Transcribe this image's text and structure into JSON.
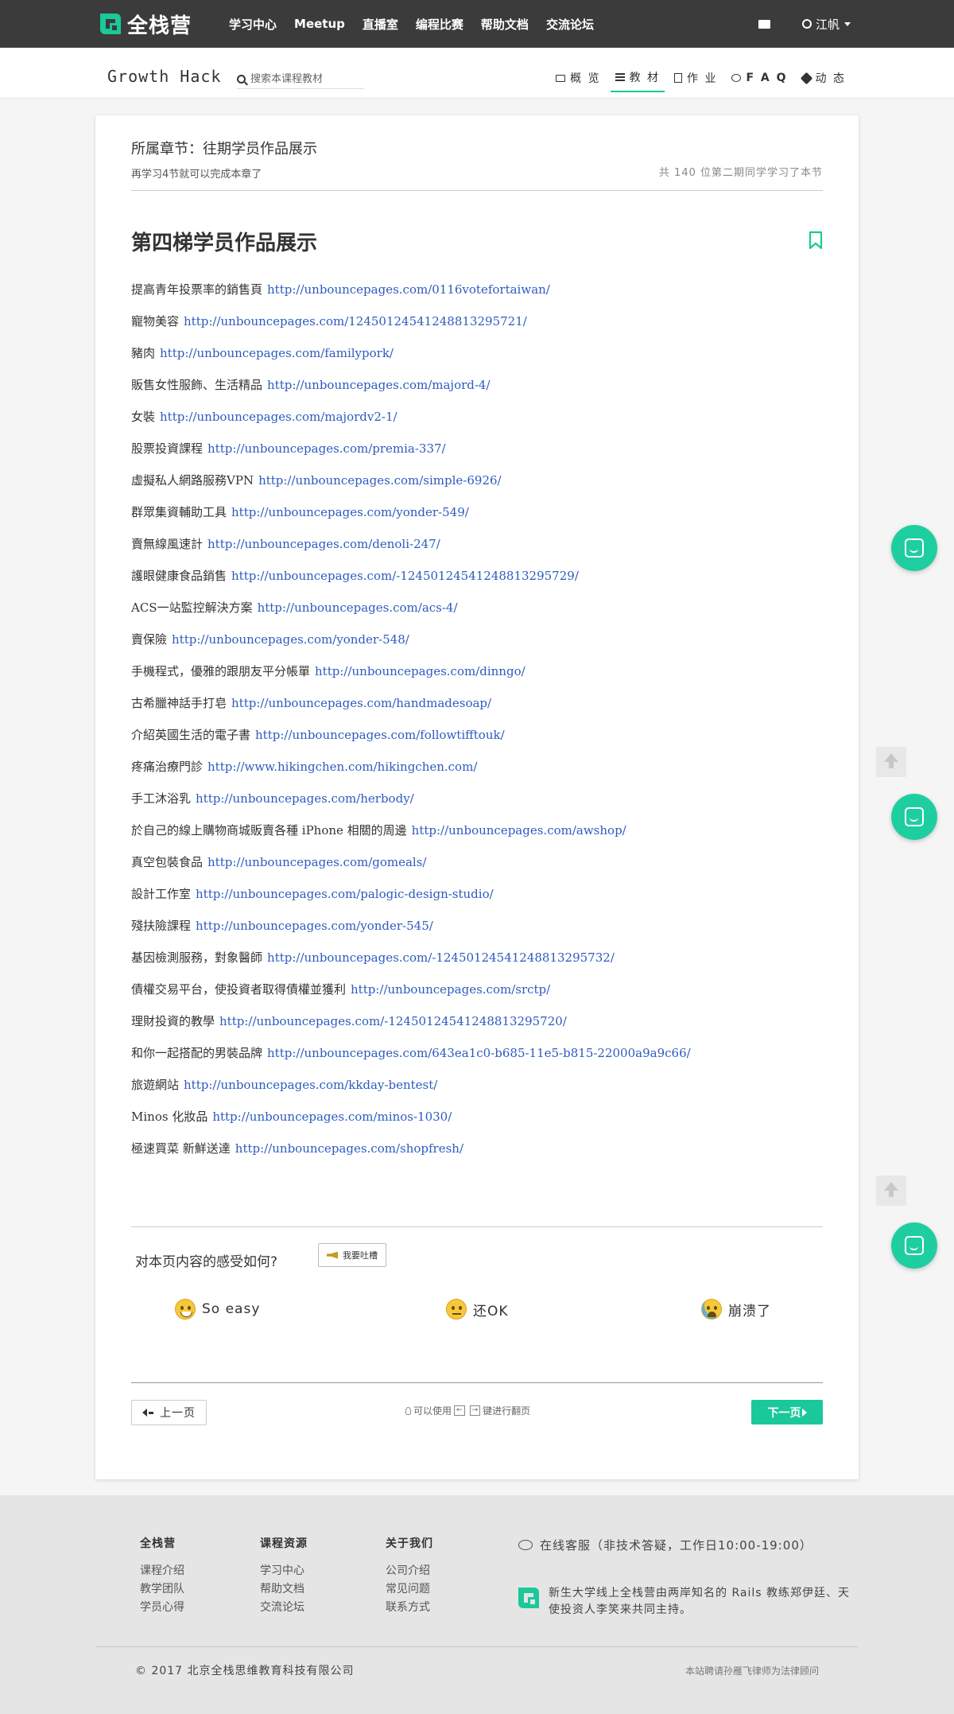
{
  "brand": {
    "name": "全栈营",
    "accent": "#1bc89a"
  },
  "topnav": {
    "links": [
      "学习中心",
      "Meetup",
      "直播室",
      "编程比赛",
      "帮助文档",
      "交流论坛"
    ],
    "user_name": "江帆"
  },
  "subhead": {
    "course_title": "Growth Hack",
    "search_placeholder": "搜索本课程教材",
    "tabs": [
      "概 览",
      "教 材",
      "作 业",
      "F A Q",
      "动 态"
    ],
    "active_tab": "教 材"
  },
  "lesson": {
    "chapter": "所属章节：往期学员作品展示",
    "progress_note": "再学习4节就可以完成本章了",
    "learners_note": "共 140 位第二期同学学习了本节",
    "heading": "第四梯学员作品展示",
    "entries": [
      {
        "label": "提高青年投票率的銷售頁",
        "url": "http://unbouncepages.com/0116votefortaiwan/"
      },
      {
        "label": "寵物美容",
        "url": "http://unbouncepages.com/12450124541248813295721/"
      },
      {
        "label": "豬肉",
        "url": "http://unbouncepages.com/familypork/"
      },
      {
        "label": "販售女性服飾、生活精品",
        "url": "http://unbouncepages.com/majord-4/"
      },
      {
        "label": "女裝",
        "url": "http://unbouncepages.com/majordv2-1/"
      },
      {
        "label": "股票投資課程",
        "url": "http://unbouncepages.com/premia-337/"
      },
      {
        "label": "虛擬私人網路服務VPN",
        "url": "http://unbouncepages.com/simple-6926/"
      },
      {
        "label": "群眾集資輔助工具",
        "url": "http://unbouncepages.com/yonder-549/"
      },
      {
        "label": "賣無線風速計",
        "url": "http://unbouncepages.com/denoli-247/"
      },
      {
        "label": "護眼健康食品銷售",
        "url": "http://unbouncepages.com/-12450124541248813295729/"
      },
      {
        "label": "ACS一站監控解決方案",
        "url": "http://unbouncepages.com/acs-4/"
      },
      {
        "label": "賣保險",
        "url": "http://unbouncepages.com/yonder-548/"
      },
      {
        "label": "手機程式，優雅的跟朋友平分帳單",
        "url": "http://unbouncepages.com/dinngo/"
      },
      {
        "label": "古希臘神話手打皂",
        "url": "http://unbouncepages.com/handmadesoap/"
      },
      {
        "label": "介紹英國生活的電子書",
        "url": "http://unbouncepages.com/followtifftouk/"
      },
      {
        "label": "疼痛治療門診",
        "url": "http://www.hikingchen.com/hikingchen.com/"
      },
      {
        "label": "手工沐浴乳",
        "url": "http://unbouncepages.com/herbody/"
      },
      {
        "label": "於自己的線上購物商城販賣各種 iPhone 相關的周邊",
        "url": "http://unbouncepages.com/awshop/"
      },
      {
        "label": "真空包裝食品",
        "url": "http://unbouncepages.com/gomeals/"
      },
      {
        "label": "設計工作室",
        "url": "http://unbouncepages.com/palogic-design-studio/"
      },
      {
        "label": "殘扶險課程",
        "url": "http://unbouncepages.com/yonder-545/"
      },
      {
        "label": "基因檢測服務，對象醫師",
        "url": "http://unbouncepages.com/-12450124541248813295732/"
      },
      {
        "label": "債權交易平台，使投資者取得債權並獲利",
        "url": "http://unbouncepages.com/srctp/"
      },
      {
        "label": "理財投資的教學",
        "url": "http://unbouncepages.com/-12450124541248813295720/"
      },
      {
        "label": "和你一起搭配的男裝品牌",
        "url": "http://unbouncepages.com/643ea1c0-b685-11e5-b815-22000a9a9c66/"
      },
      {
        "label": "旅遊網站",
        "url": "http://unbouncepages.com/kkday-bentest/"
      },
      {
        "label": "Minos 化妝品",
        "url": "http://unbouncepages.com/minos-1030/"
      },
      {
        "label": "極速買菜 新鮮送達",
        "url": "http://unbouncepages.com/shopfresh/"
      }
    ]
  },
  "feedback": {
    "question": "对本页内容的感受如何?",
    "rant_button": "我要吐槽",
    "moods": [
      "So easy",
      "还OK",
      "崩溃了"
    ]
  },
  "pager": {
    "prev": "上一页",
    "hint_prefix": "可以使用",
    "key_left": "←",
    "key_right": "→",
    "hint_suffix": "键进行翻页",
    "next": "下一页"
  },
  "footer": {
    "col1": {
      "title": "全栈营",
      "links": [
        "课程介绍",
        "教学团队",
        "学员心得"
      ]
    },
    "col2": {
      "title": "课程资源",
      "links": [
        "学习中心",
        "帮助文档",
        "交流论坛"
      ]
    },
    "col3": {
      "title": "关于我们",
      "links": [
        "公司介绍",
        "常见问题",
        "联系方式"
      ]
    },
    "service": "在线客服（非技术答疑，工作日10:00-19:00）",
    "about": "新生大学线上全栈营由两岸知名的 Rails 教练郑伊廷、天使投资人李笑来共同主持。",
    "copyright": "© 2017 北京全栈思维教育科技有限公司",
    "legal": "本站聘请孙雁飞律师为法律顾问"
  }
}
